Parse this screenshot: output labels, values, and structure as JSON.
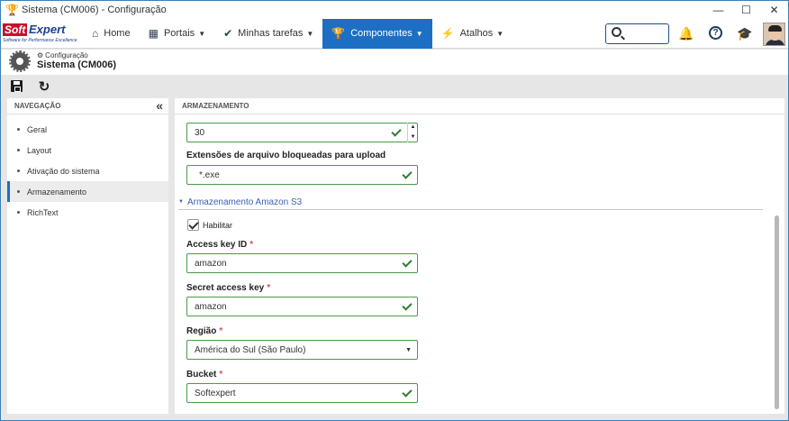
{
  "window": {
    "title": "Sistema (CM006) - Configuração",
    "controls": [
      "—",
      "☐",
      "✕"
    ]
  },
  "brand": {
    "name_part1": "Soft",
    "name_part2": "Expert",
    "tagline": "Software for Performance Excellence"
  },
  "nav": {
    "items": [
      {
        "label": "Home",
        "icon": "home-icon"
      },
      {
        "label": "Portais",
        "icon": "dashboard-icon"
      },
      {
        "label": "Minhas tarefas",
        "icon": "check-icon"
      },
      {
        "label": "Componentes",
        "icon": "trophy-icon"
      },
      {
        "label": "Atalhos",
        "icon": "lightning-icon"
      }
    ],
    "search_placeholder": ""
  },
  "header": {
    "breadcrumb": "Configuração",
    "title": "Sistema (CM006)"
  },
  "sidebar": {
    "heading": "NAVEGAÇÃO",
    "items": [
      {
        "label": "Geral"
      },
      {
        "label": "Layout"
      },
      {
        "label": "Ativação do sistema"
      },
      {
        "label": "Armazenamento"
      },
      {
        "label": "RichText"
      }
    ],
    "active_index": 3
  },
  "main": {
    "heading": "ARMAZENAMENTO",
    "size_field": {
      "value": "30"
    },
    "blocked_ext": {
      "label": "Extensões de arquivo bloqueadas para upload",
      "value": "*.exe"
    },
    "section": {
      "title": "Armazenamento Amazon S3"
    },
    "enable": {
      "label": "Habilitar",
      "checked": true
    },
    "access_key": {
      "label": "Access key ID",
      "value": "amazon"
    },
    "secret_key": {
      "label": "Secret access key",
      "value": "amazon"
    },
    "region": {
      "label": "Região",
      "value": "América do Sul (São Paulo)"
    },
    "bucket": {
      "label": "Bucket",
      "value": "Softexpert"
    }
  },
  "colors": {
    "accent": "#1d6fc4",
    "valid_border": "#4a9a4a",
    "required": "#d9534f",
    "section_link": "#3a63b5"
  }
}
